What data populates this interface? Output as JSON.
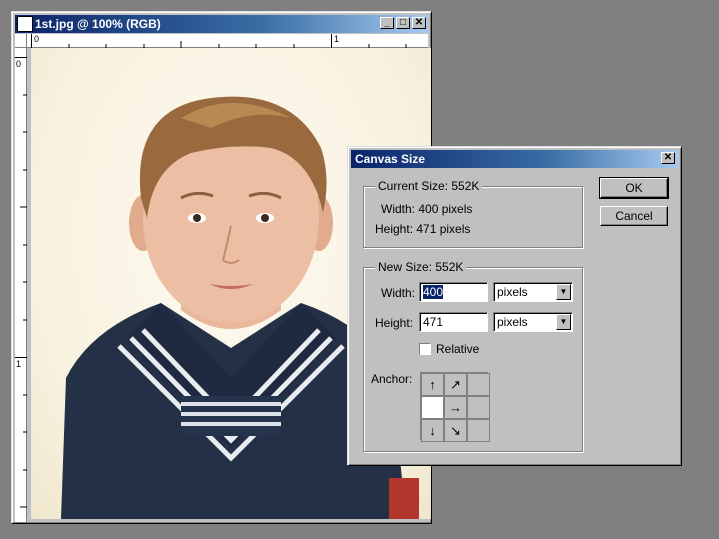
{
  "document": {
    "title": "1st.jpg @ 100% (RGB)",
    "ruler_h_labels": [
      "0",
      "1"
    ],
    "ruler_v_labels": [
      "0",
      "1"
    ],
    "buttons": {
      "minimize": "_",
      "maximize": "□",
      "close": "✕"
    }
  },
  "dialog": {
    "title": "Canvas Size",
    "close_glyph": "✕",
    "current_size": {
      "heading": "Current Size:  552K",
      "width_text": "Width:  400 pixels",
      "height_text": "Height:  471 pixels"
    },
    "new_size": {
      "heading": "New Size:  552K",
      "width_label": "Width:",
      "width_value": "400",
      "width_unit": "pixels",
      "height_label": "Height:",
      "height_value": "471",
      "height_unit": "pixels",
      "relative_label": "Relative",
      "relative_checked": false,
      "anchor_label": "Anchor:",
      "anchor_cells": [
        "↑",
        "↗",
        "",
        "",
        "→",
        "",
        "↓",
        "↘",
        ""
      ],
      "anchor_selected_index": 3
    },
    "ok_label": "OK",
    "cancel_label": "Cancel"
  },
  "colors": {
    "titlebar_start": "#0a246a",
    "titlebar_end": "#a6caf0",
    "face": "#c0c0c0",
    "desktop": "#808080"
  }
}
